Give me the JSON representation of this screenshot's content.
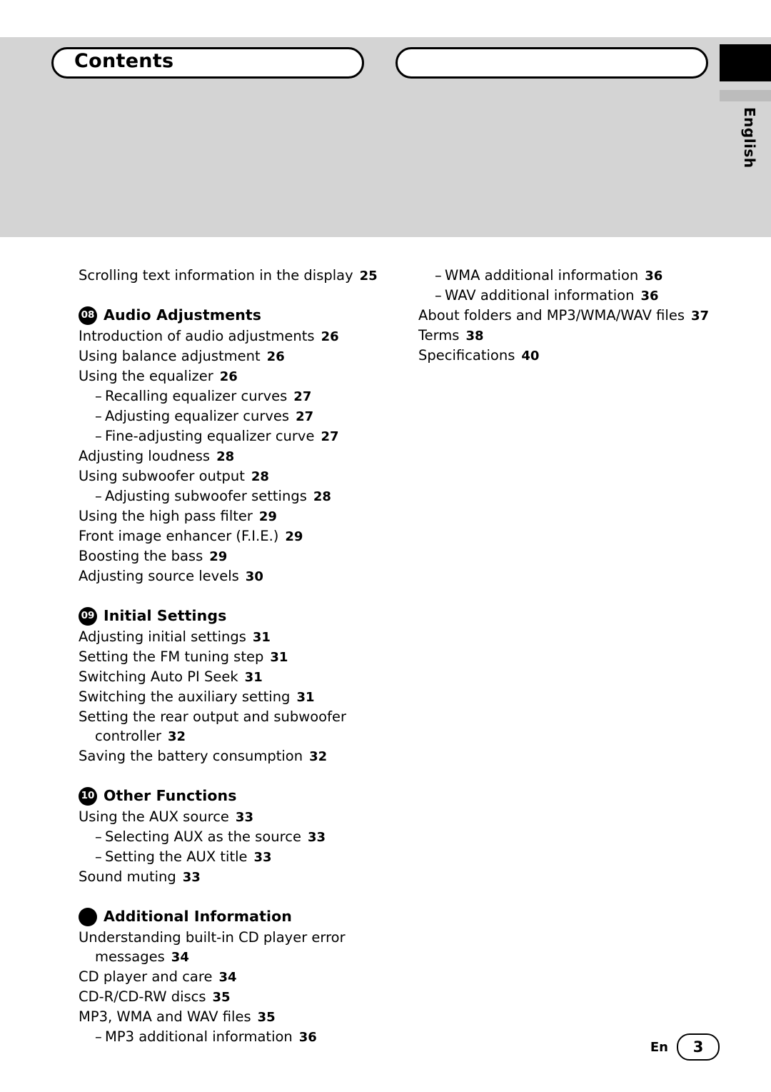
{
  "header": {
    "title": "Contents",
    "language_tab": "English"
  },
  "footer": {
    "en_label": "En",
    "page_number": "3"
  },
  "columns": {
    "left": [
      {
        "type": "entry",
        "text": "Scrolling text information in the display",
        "page": "25"
      },
      {
        "type": "section",
        "badge": "08",
        "title": "Audio Adjustments",
        "items": [
          {
            "type": "entry",
            "text": "Introduction of audio adjustments",
            "page": "26"
          },
          {
            "type": "entry",
            "text": "Using balance adjustment",
            "page": "26"
          },
          {
            "type": "entry",
            "text": "Using the equalizer",
            "page": "26"
          },
          {
            "type": "sub",
            "text": "Recalling equalizer curves",
            "page": "27"
          },
          {
            "type": "sub",
            "text": "Adjusting equalizer curves",
            "page": "27"
          },
          {
            "type": "sub",
            "text": "Fine-adjusting equalizer curve",
            "page": "27"
          },
          {
            "type": "entry",
            "text": "Adjusting loudness",
            "page": "28"
          },
          {
            "type": "entry",
            "text": "Using subwoofer output",
            "page": "28"
          },
          {
            "type": "sub",
            "text": "Adjusting subwoofer settings",
            "page": "28"
          },
          {
            "type": "entry",
            "text": "Using the high pass filter",
            "page": "29"
          },
          {
            "type": "entry",
            "text": "Front image enhancer (F.I.E.)",
            "page": "29"
          },
          {
            "type": "entry",
            "text": "Boosting the bass",
            "page": "29"
          },
          {
            "type": "entry",
            "text": "Adjusting source levels",
            "page": "30"
          }
        ]
      },
      {
        "type": "section",
        "badge": "09",
        "title": "Initial Settings",
        "items": [
          {
            "type": "entry",
            "text": "Adjusting initial settings",
            "page": "31"
          },
          {
            "type": "entry",
            "text": "Setting the FM tuning step",
            "page": "31"
          },
          {
            "type": "entry",
            "text": "Switching Auto PI Seek",
            "page": "31"
          },
          {
            "type": "entry",
            "text": "Switching the auxiliary setting",
            "page": "31"
          },
          {
            "type": "wrap",
            "text": "Setting the rear output and subwoofer",
            "cont": "controller",
            "page": "32"
          },
          {
            "type": "entry",
            "text": "Saving the battery consumption",
            "page": "32"
          }
        ]
      },
      {
        "type": "section",
        "badge": "10",
        "title": "Other Functions",
        "items": [
          {
            "type": "entry",
            "text": "Using the AUX source",
            "page": "33"
          },
          {
            "type": "sub",
            "text": "Selecting AUX as the source",
            "page": "33"
          },
          {
            "type": "sub",
            "text": "Setting the AUX title",
            "page": "33"
          },
          {
            "type": "entry",
            "text": "Sound muting",
            "page": "33"
          }
        ]
      },
      {
        "type": "section",
        "badge": "",
        "title": "Additional Information",
        "items": [
          {
            "type": "wrap",
            "text": "Understanding built-in CD player error",
            "cont": "messages",
            "page": "34"
          },
          {
            "type": "entry",
            "text": "CD player and care",
            "page": "34"
          },
          {
            "type": "entry",
            "text": "CD-R/CD-RW discs",
            "page": "35"
          },
          {
            "type": "entry",
            "text": "MP3, WMA and WAV files",
            "page": "35"
          },
          {
            "type": "sub",
            "text": "MP3 additional information",
            "page": "36"
          }
        ]
      }
    ],
    "right": [
      {
        "type": "sub",
        "text": "WMA additional information",
        "page": "36"
      },
      {
        "type": "sub",
        "text": "WAV additional information",
        "page": "36"
      },
      {
        "type": "entry",
        "text": "About folders and MP3/WMA/WAV files",
        "page": "37"
      },
      {
        "type": "entry",
        "text": "Terms",
        "page": "38"
      },
      {
        "type": "entry",
        "text": "Specifications",
        "page": "40"
      }
    ]
  }
}
